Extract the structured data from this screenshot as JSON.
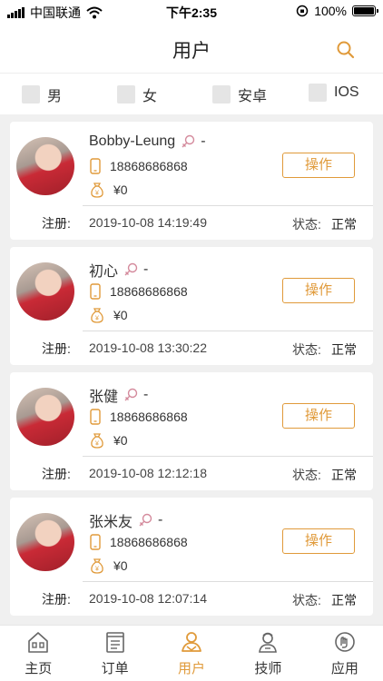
{
  "status_bar": {
    "carrier": "中国联通",
    "time": "下午2:35",
    "battery": "100%"
  },
  "header": {
    "title": "用户"
  },
  "filters": [
    {
      "label": "男",
      "checked": false
    },
    {
      "label": "女",
      "checked": false
    },
    {
      "label": "安卓",
      "checked": false
    },
    {
      "label": "IOS",
      "checked": false
    }
  ],
  "users": [
    {
      "name": "Bobby-Leung",
      "gender_text": "-",
      "phone": "18868686868",
      "balance": "¥0",
      "reg_label": "注册:",
      "reg_time": "2019-10-08 14:19:49",
      "state_label": "状态:",
      "state": "正常",
      "action": "操作"
    },
    {
      "name": "初心",
      "gender_text": "-",
      "phone": "18868686868",
      "balance": "¥0",
      "reg_label": "注册:",
      "reg_time": "2019-10-08 13:30:22",
      "state_label": "状态:",
      "state": "正常",
      "action": "操作"
    },
    {
      "name": "张健",
      "gender_text": "-",
      "phone": "18868686868",
      "balance": "¥0",
      "reg_label": "注册:",
      "reg_time": "2019-10-08 12:12:18",
      "state_label": "状态:",
      "state": "正常",
      "action": "操作"
    },
    {
      "name": "张米友",
      "gender_text": "-",
      "phone": "18868686868",
      "balance": "¥0",
      "reg_label": "注册:",
      "reg_time": "2019-10-08 12:07:14",
      "state_label": "状态:",
      "state": "正常",
      "action": "操作"
    }
  ],
  "tabs": [
    {
      "label": "主页",
      "icon": "home-icon"
    },
    {
      "label": "订单",
      "icon": "order-icon"
    },
    {
      "label": "用户",
      "icon": "user-icon",
      "active": true
    },
    {
      "label": "技师",
      "icon": "technician-icon"
    },
    {
      "label": "应用",
      "icon": "apps-icon"
    }
  ],
  "colors": {
    "accent": "#e09a3a",
    "gender_icon": "#d48a9c"
  }
}
